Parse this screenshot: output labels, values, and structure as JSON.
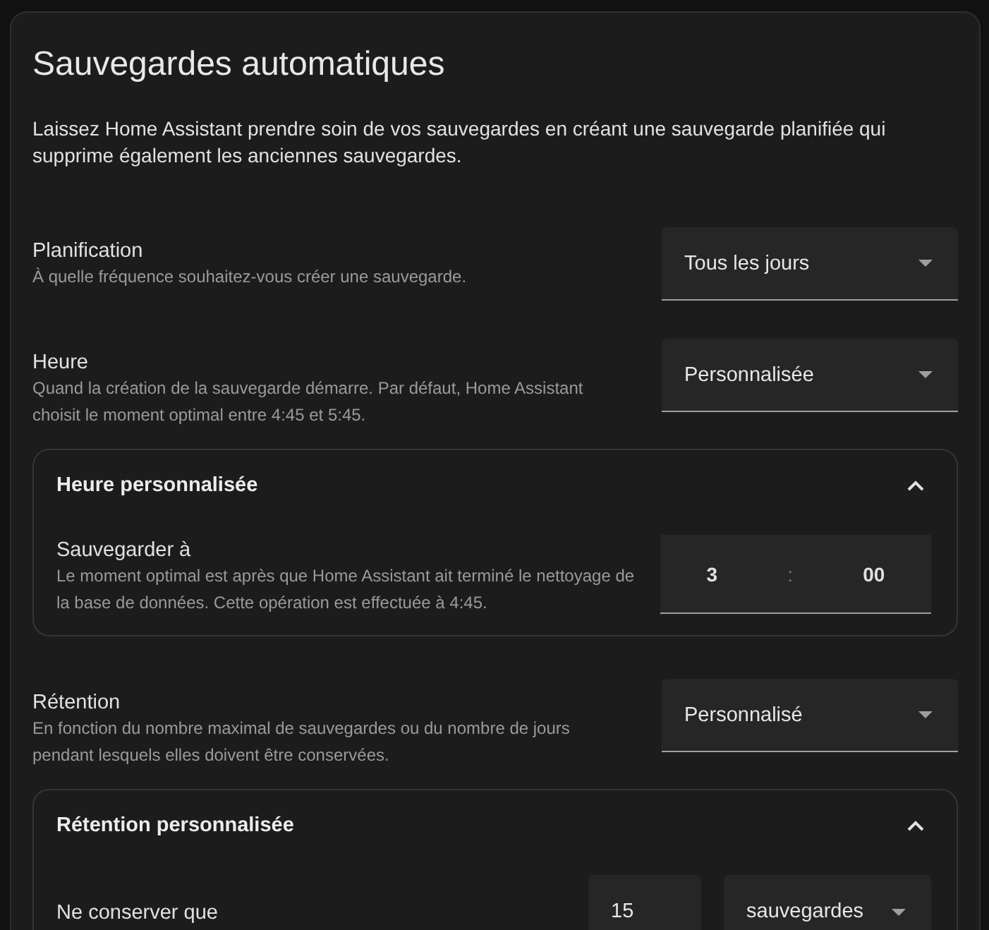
{
  "title": "Sauvegardes automatiques",
  "description": "Laissez Home Assistant prendre soin de vos sauvegardes en créant une sauvegarde planifiée qui supprime également les anciennes sauvegardes.",
  "sections": [
    {
      "label": "Planification",
      "description": "À quelle fréquence souhaitez-vous créer une sauvegarde.",
      "select": "Tous les jours"
    },
    {
      "label": "Heure",
      "description": "Quand la création de la sauvegarde démarre. Par défaut, Home Assistant choisit le moment optimal entre 4:45 et 5:45.",
      "select": "Personnalisée",
      "panel": {
        "title": "Heure personnalisée",
        "expanded": true,
        "row": {
          "kind": "time",
          "label": "Sauvegarder à",
          "description": "Le moment optimal est après que Home Assistant ait terminé le nettoyage de la base de données. Cette opération est effectuée à 4:45.",
          "hours": "3",
          "separator": ":",
          "minutes": "00"
        }
      }
    },
    {
      "label": "Rétention",
      "description": "En fonction du nombre maximal de sauvegardes ou du nombre de jours pendant lesquels elles doivent être conservées.",
      "select": "Personnalisé",
      "panel": {
        "title": "Rétention personnalisée",
        "expanded": true,
        "row": {
          "kind": "count",
          "label": "Ne conserver que",
          "count": "15",
          "unit": "sauvegardes"
        }
      }
    }
  ]
}
